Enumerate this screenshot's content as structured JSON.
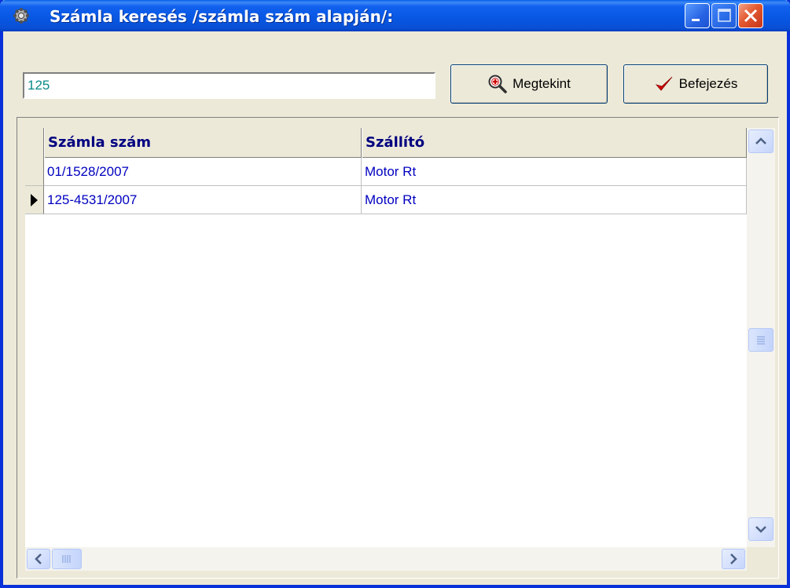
{
  "window": {
    "title": "Számla keresés /számla szám alapján/:",
    "title_icon": "gear-icon"
  },
  "search": {
    "value": "125"
  },
  "buttons": {
    "view_label": "Megtekint",
    "view_icon": "magnifier-plus-icon",
    "finish_label": "Befejezés",
    "finish_icon": "checkmark-icon"
  },
  "table": {
    "columns": [
      "Számla szám",
      "Szállító"
    ],
    "rows": [
      {
        "invoice": "01/1528/2007",
        "supplier": "Motor Rt",
        "current": false
      },
      {
        "invoice": "125-4531/2007",
        "supplier": "Motor Rt",
        "current": true
      }
    ]
  },
  "colors": {
    "titlebar": "#0757e3",
    "header_text": "#000080",
    "cell_text": "#0000c0",
    "input_text": "#0a8a8a",
    "check": "#d40000"
  }
}
